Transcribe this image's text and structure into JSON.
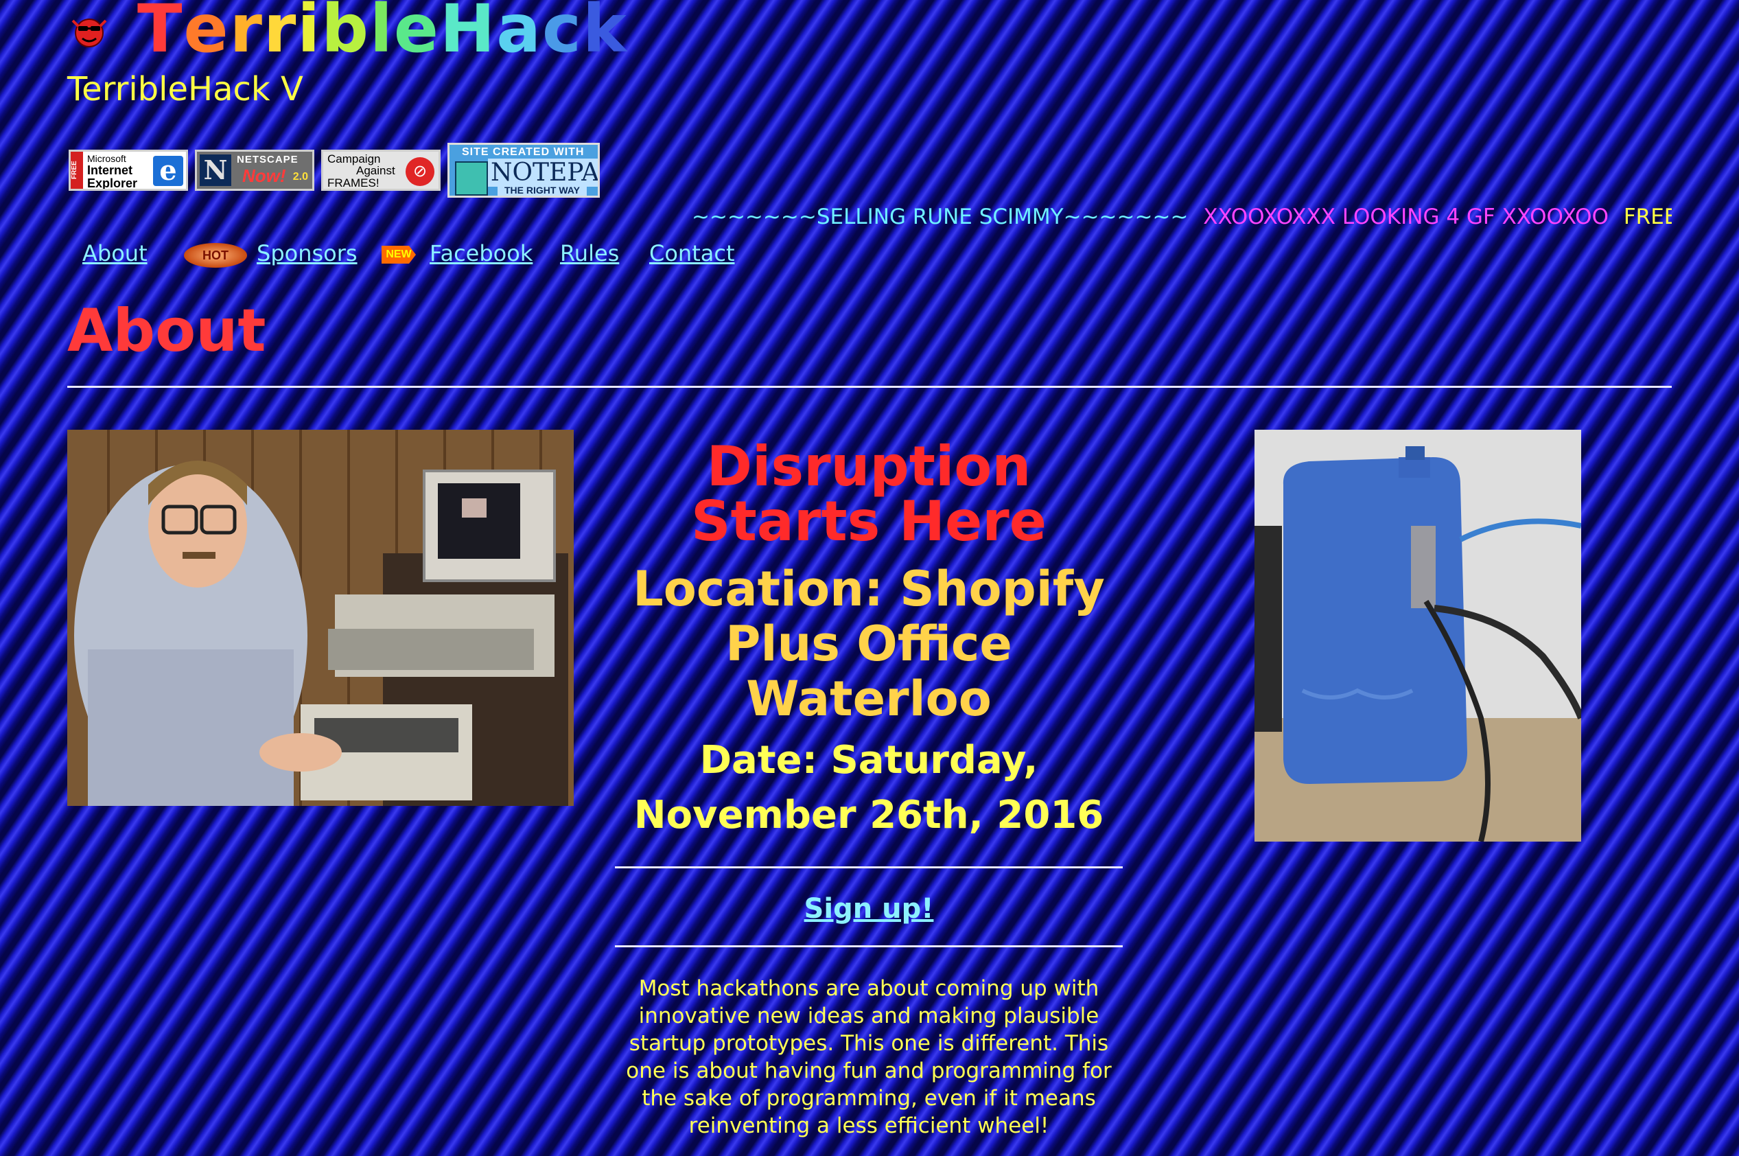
{
  "header": {
    "title_letters": [
      {
        "ch": "T",
        "color": "#ff3a3a"
      },
      {
        "ch": "e",
        "color": "#ff7a2a"
      },
      {
        "ch": "r",
        "color": "#ffb02a"
      },
      {
        "ch": "r",
        "color": "#ffd83a"
      },
      {
        "ch": "i",
        "color": "#e8f03a"
      },
      {
        "ch": "b",
        "color": "#b8f040"
      },
      {
        "ch": "l",
        "color": "#7ae860"
      },
      {
        "ch": "e",
        "color": "#5ae88a"
      },
      {
        "ch": "H",
        "color": "#5ae8c8"
      },
      {
        "ch": "a",
        "color": "#5ad0f0"
      },
      {
        "ch": "c",
        "color": "#4a9ae8"
      },
      {
        "ch": "k",
        "color": "#3a5ae0"
      }
    ],
    "subtitle": "TerribleHack V"
  },
  "badges": {
    "ie": {
      "strip": "FREE",
      "line1": "Microsoft",
      "line2": "Internet",
      "line3": "Explorer",
      "logo": "e"
    },
    "netscape": {
      "logo": "N",
      "line1": "NETSCAPE",
      "line2": "Now!",
      "version": "2.0"
    },
    "frames": {
      "line1": "Campaign",
      "line2": "Against",
      "line3": "FRAMES!",
      "stop": "⊘"
    },
    "notepad": {
      "line1": "SITE CREATED WITH",
      "line2": "NOTEPAD",
      "line3": "THE RIGHT WAY"
    }
  },
  "marquee": [
    "~~~~~~~SELLING RUNE SCIMMY~~~~~~~",
    "XXOOXOXXX LOOKING 4 GF XXOOXOO",
    "FREE AI"
  ],
  "nav": {
    "about": "About",
    "hot": "HOT",
    "sponsors": "Sponsors",
    "new": "NEW",
    "facebook": "Facebook",
    "rules": "Rules",
    "contact": "Contact"
  },
  "main": {
    "heading": "About",
    "headline_1": "Disruption",
    "headline_2": "Starts Here",
    "location": "Location: Shopify Plus Office Waterloo",
    "date": "Date: Saturday, November 26th, 2016",
    "signup": "Sign up!",
    "description": "Most hackathons are about coming up with innovative new ideas and making plausible startup prototypes. This one is different. This one is about having fun and programming for the sake of programming, even if it means reinventing a less efficient wheel!"
  },
  "colors": {
    "background": "#1212a8",
    "heading": "#ff3a3a",
    "link": "#8cf0ff",
    "yellow_text": "#ffff55",
    "gold_text": "#ffd24a"
  }
}
